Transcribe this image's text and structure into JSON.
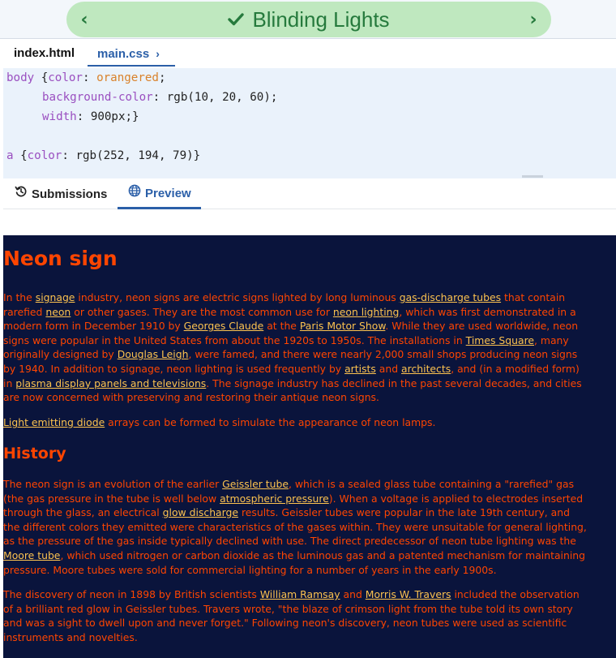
{
  "banner": {
    "title": "Blinding Lights",
    "prev": "‹",
    "next": "›"
  },
  "files": [
    {
      "label": "index.html"
    },
    {
      "label": "main.css",
      "chevron": "›"
    }
  ],
  "code": {
    "l1": {
      "sel": "body",
      "brace": " {",
      "prop": "color",
      "colon": ": ",
      "val": "orangered",
      "end": ";"
    },
    "l2": {
      "prop": "background-color",
      "colon": ": ",
      "val": "rgb(10, 20, 60);"
    },
    "l3": {
      "prop": "width",
      "colon": ": ",
      "val": "900px;}"
    },
    "l4": {
      "sel": "a",
      "brace": " {",
      "prop": "color",
      "colon": ": ",
      "val": "rgb(252, 194, 79)}"
    }
  },
  "outtabs": {
    "submissions": "Submissions",
    "preview": "Preview"
  },
  "preview": {
    "h1": "Neon sign",
    "p1": {
      "t0": "In the ",
      "a0": "signage",
      "t1": " industry, neon signs are electric signs lighted by long luminous ",
      "a1": "gas-discharge tubes",
      "t2": " that contain rarefied ",
      "a2": "neon",
      "t3": " or other gases. They are the most common use for ",
      "a3": "neon lighting",
      "t4": ", which was first demonstrated in a modern form in December 1910 by ",
      "a4": "Georges Claude",
      "t5": " at the ",
      "a5": "Paris Motor Show",
      "t6": ". While they are used worldwide, neon signs were popular in the United States from about the 1920s to 1950s. The installations in ",
      "a6": "Times Square",
      "t7": ", many originally designed by ",
      "a7": "Douglas Leigh",
      "t8": ", were famed, and there were nearly 2,000 small shops producing neon signs by 1940. In addition to signage, neon lighting is used frequently by ",
      "a8": "artists",
      "t9": " and ",
      "a9": "architects",
      "t10": ", and (in a modified form) in ",
      "a10": "plasma display panels and televisions",
      "t11": ". The signage industry has declined in the past several decades, and cities are now concerned with preserving and restoring their antique neon signs."
    },
    "p2": {
      "a0": "Light emitting diode",
      "t0": " arrays can be formed to simulate the appearance of neon lamps."
    },
    "h2": "History",
    "p3": {
      "t0": "The neon sign is an evolution of the earlier ",
      "a0": "Geissler tube",
      "t1": ", which is a sealed glass tube containing a \"rarefied\" gas (the gas pressure in the tube is well below ",
      "a1": "atmospheric pressure",
      "t2": "). When a voltage is applied to electrodes inserted through the glass, an electrical ",
      "a2": "glow discharge",
      "t3": " results. Geissler tubes were popular in the late 19th century, and the different colors they emitted were characteristics of the gases within. They were unsuitable for general lighting, as the pressure of the gas inside typically declined with use. The direct predecessor of neon tube lighting was the ",
      "a3": "Moore tube",
      "t4": ", which used nitrogen or carbon dioxide as the luminous gas and a patented mechanism for maintaining pressure. Moore tubes were sold for commercial lighting for a number of years in the early 1900s."
    },
    "p4": {
      "t0": "The discovery of neon in 1898 by British scientists ",
      "a0": "William Ramsay",
      "t1": " and ",
      "a1": "Morris W. Travers",
      "t2": " included the observation of a brilliant red glow in Geissler tubes. Travers wrote, \"the blaze of crimson light from the tube told its own story and was a sight to dwell upon and never forget.\" Following neon's discovery, neon tubes were used as scientific instruments and novelties."
    }
  },
  "icons": {
    "check": "check-icon",
    "history": "history-icon",
    "globe": "globe-icon"
  },
  "colors": {
    "accent": "#2b5fa8",
    "banner_bg": "#bfe8bf",
    "banner_text": "#267a3d",
    "preview_bg": "rgb(10, 20, 60)",
    "link": "rgb(252, 194, 79)",
    "text": "orangered"
  }
}
